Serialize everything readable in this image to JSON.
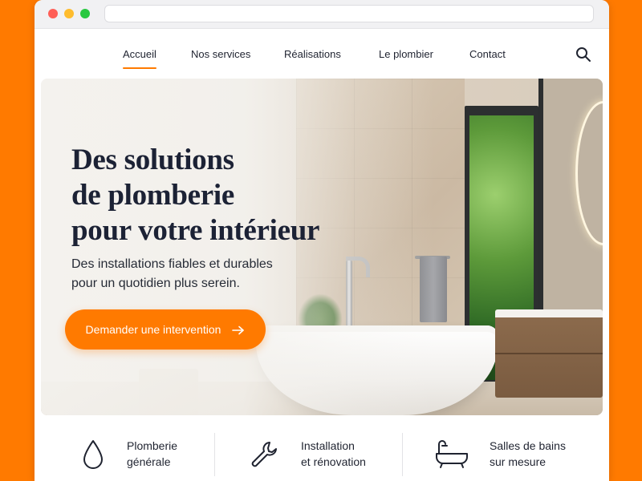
{
  "colors": {
    "accent": "#FF7A00",
    "page_bg": "#FF7A00",
    "text": "#1c2235"
  },
  "browser": {
    "url": ""
  },
  "nav": {
    "items": [
      {
        "label": "Accueil",
        "active": true
      },
      {
        "label": "Nos services",
        "active": false
      },
      {
        "label": "Réalisations",
        "active": false
      },
      {
        "label": "Le plombier",
        "active": false
      },
      {
        "label": "Contact",
        "active": false
      }
    ],
    "search_icon": "search-icon"
  },
  "hero": {
    "title_lines": [
      "Des solutions",
      "de plomberie",
      "pour votre intérieur"
    ],
    "subtitle_lines": [
      "Des installations fiables et durables",
      "pour un quotidien plus serein."
    ],
    "cta_label": "Demander une intervention",
    "cta_icon": "arrow-right-icon"
  },
  "services": [
    {
      "icon": "water-drop-icon",
      "label_lines": [
        "Plomberie",
        "générale"
      ]
    },
    {
      "icon": "wrench-icon",
      "label_lines": [
        "Installation",
        "et rénovation"
      ]
    },
    {
      "icon": "bathtub-icon",
      "label_lines": [
        "Salles de bains",
        "sur mesure"
      ]
    }
  ]
}
